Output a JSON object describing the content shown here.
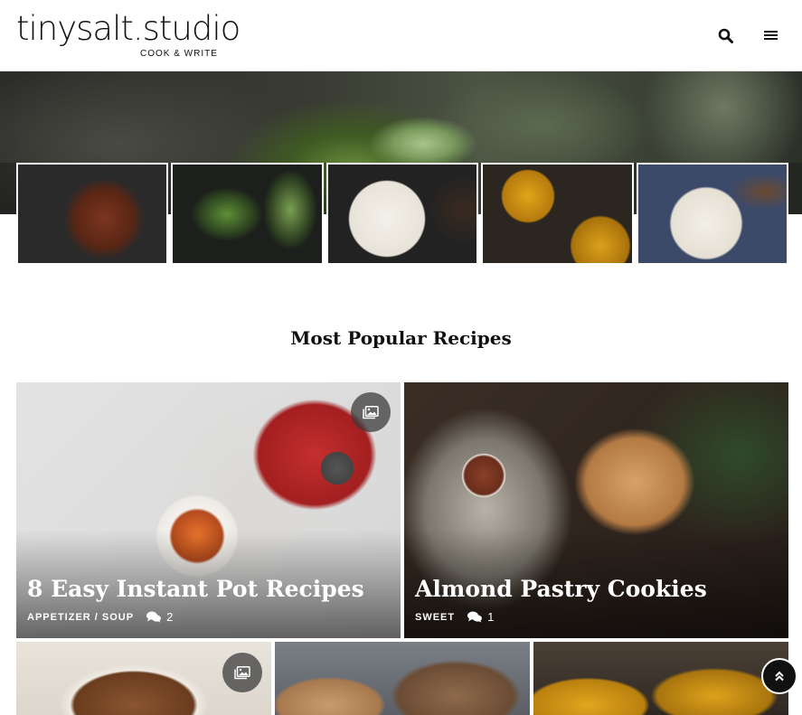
{
  "header": {
    "logo_main": "tinysalt.studio",
    "logo_tagline": "COOK & WRITE",
    "search_icon": "search-icon",
    "menu_icon": "hamburger-menu-icon"
  },
  "slider": {
    "thumbnails": [
      {
        "alt": "Bolognese in pot"
      },
      {
        "alt": "Pickled vegetables in jars"
      },
      {
        "alt": "Roasted potatoes on plate"
      },
      {
        "alt": "Pumpkin soup with noodles"
      },
      {
        "alt": "Breakfast plate with egg"
      }
    ]
  },
  "popular": {
    "title": "Most Popular Recipes",
    "cards": [
      {
        "title": "8 Easy Instant Pot Recipes",
        "categories": "APPETIZER / SOUP",
        "comments": "2",
        "gallery": true
      },
      {
        "title": "Almond Pastry Cookies",
        "categories": "SWEET",
        "comments": "1",
        "gallery": false
      }
    ]
  },
  "colors": {
    "text": "#111111",
    "badge": "#3c3c3c",
    "top_button": "#111111"
  }
}
